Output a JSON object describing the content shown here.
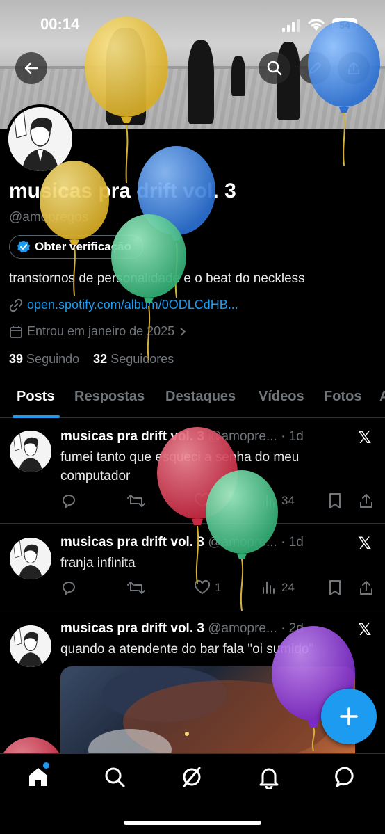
{
  "status_bar": {
    "time": "00:14",
    "battery": "54"
  },
  "header": {
    "back_icon": "arrow-left-icon",
    "search_icon": "search-icon",
    "edit_icon": "pencil-icon",
    "share_icon": "share-icon"
  },
  "profile": {
    "display_name": "musicas pra drift vol. 3",
    "handle": "@amopregos",
    "verify_label": "Obter verificação",
    "bio": "transtornos de personalidade e o beat do neckless",
    "link": "open.spotify.com/album/0ODLCdHB...",
    "joined": "Entrou em janeiro de 2025",
    "following_count": "39",
    "following_label": "Seguindo",
    "followers_count": "32",
    "followers_label": "Seguidores"
  },
  "tabs": [
    "Posts",
    "Respostas",
    "Destaques",
    "Vídeos",
    "Fotos",
    "A"
  ],
  "posts": [
    {
      "name": "musicas pra drift vol. 3",
      "handle": "@amopre...",
      "time": "· 1d",
      "text": "fumei tanto que esqueci a senha do meu computador",
      "likes": "1",
      "views": "34"
    },
    {
      "name": "musicas pra drift vol. 3",
      "handle": "@amopre...",
      "time": "· 1d",
      "text": "franja infinita",
      "likes": "1",
      "views": "24"
    },
    {
      "name": "musicas pra drift vol. 3",
      "handle": "@amopre...",
      "time": "· 2d",
      "text": "quando a atendente do bar fala \"oi sumido\""
    }
  ],
  "colors": {
    "accent": "#1d9bf0",
    "background": "#000000",
    "muted_text": "#71767b",
    "balloon_yellow": "#e7c13f",
    "balloon_blue": "#3d8ae0",
    "balloon_green": "#4cc38a",
    "balloon_red": "#d5384f",
    "balloon_purple": "#8a3ad2"
  }
}
